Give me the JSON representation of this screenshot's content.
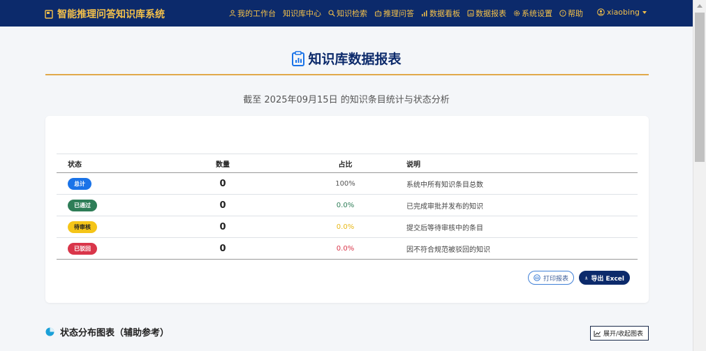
{
  "app": {
    "title": "智能推理问答知识库系统"
  },
  "nav": {
    "items": [
      {
        "label": "我的工作台",
        "icon": "user-icon"
      },
      {
        "label": "知识库中心",
        "icon": ""
      },
      {
        "label": "知识检索",
        "icon": "search-icon"
      },
      {
        "label": "推理问答",
        "icon": "robot-icon"
      },
      {
        "label": "数据看板",
        "icon": "bar-chart-icon"
      },
      {
        "label": "数据报表",
        "icon": "report-icon"
      },
      {
        "label": "系统设置",
        "icon": "gear-icon"
      },
      {
        "label": "帮助",
        "icon": "help-icon"
      }
    ],
    "user": "xiaobing"
  },
  "page": {
    "title": "知识库数据报表",
    "subtitle": "截至 2025年09月15日 的知识条目统计与状态分析"
  },
  "table": {
    "headers": [
      "状态",
      "数量",
      "占比",
      "说明"
    ],
    "rows": [
      {
        "status": "总计",
        "count": "0",
        "percent": "100%",
        "desc": "系统中所有知识条目总数",
        "color": "#1a73e8",
        "badge_text": "#ffffff",
        "percent_color": "#555555"
      },
      {
        "status": "已通过",
        "count": "0",
        "percent": "0.0%",
        "desc": "已完成审批并发布的知识",
        "color": "#2e7d57",
        "badge_text": "#ffffff",
        "percent_color": "#2e7d57"
      },
      {
        "status": "待审核",
        "count": "0",
        "percent": "0.0%",
        "desc": "提交后等待审核中的条目",
        "color": "#f5c518",
        "badge_text": "#222222",
        "percent_color": "#e8b818"
      },
      {
        "status": "已驳回",
        "count": "0",
        "percent": "0.0%",
        "desc": "因不符合规范被驳回的知识",
        "color": "#d9364a",
        "badge_text": "#ffffff",
        "percent_color": "#d9364a"
      }
    ]
  },
  "actions": {
    "print_label": "打印报表",
    "export_label": "导出 Excel"
  },
  "section": {
    "title": "状态分布图表（辅助参考）",
    "toggle_label": "展开/收起图表"
  },
  "colors": {
    "navbar": "#0c2a6b",
    "accent": "#f3c04a",
    "rule": "#e0a94a"
  }
}
